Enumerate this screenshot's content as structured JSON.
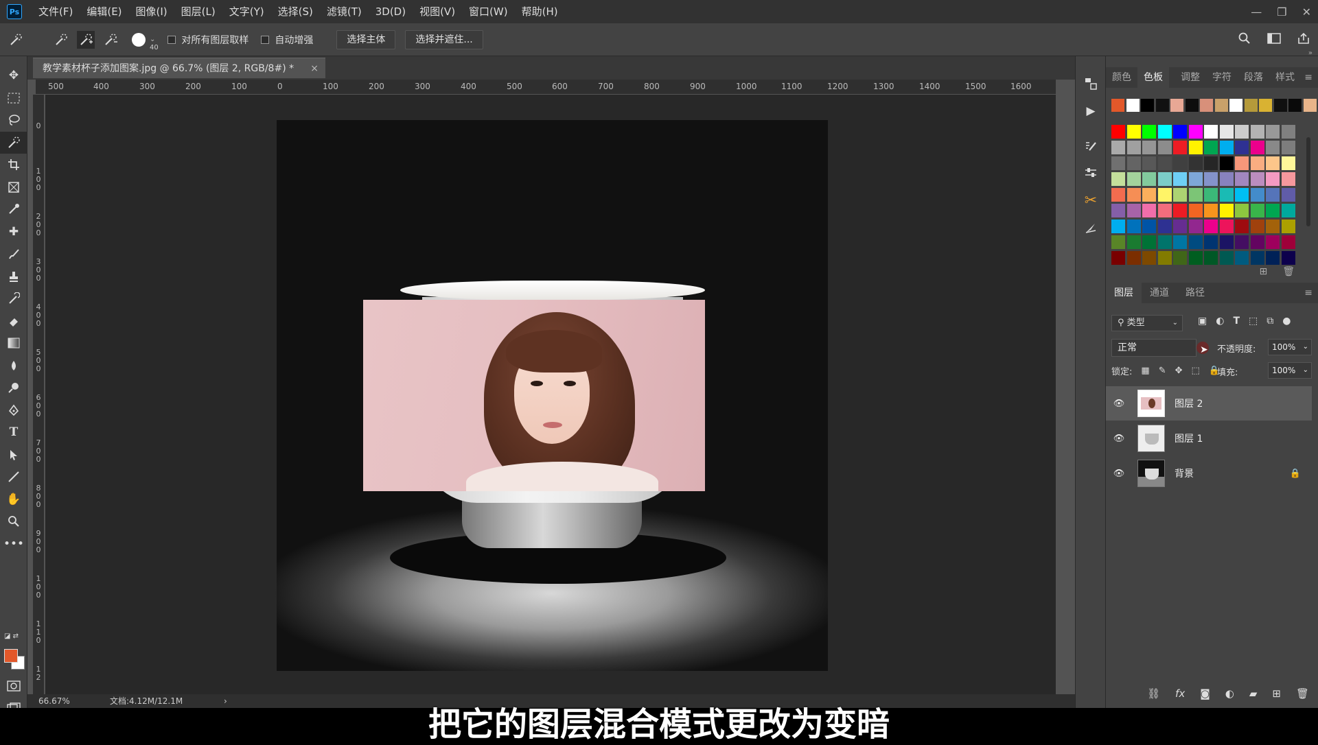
{
  "menubar": {
    "logo": "Ps",
    "items": [
      "文件(F)",
      "编辑(E)",
      "图像(I)",
      "图层(L)",
      "文字(Y)",
      "选择(S)",
      "滤镜(T)",
      "3D(D)",
      "视图(V)",
      "窗口(W)",
      "帮助(H)"
    ]
  },
  "options": {
    "brush_size": "40",
    "sample_all_label": "对所有图层取样",
    "auto_enhance_label": "自动增强",
    "select_subject": "选择主体",
    "select_mask": "选择并遮住..."
  },
  "document": {
    "tab_title": "教学素材杯子添加图案.jpg @ 66.7% (图层 2, RGB/8#) *",
    "close": "×",
    "ruler_top": [
      "500",
      "400",
      "300",
      "200",
      "100",
      "0",
      "100",
      "200",
      "300",
      "400",
      "500",
      "600",
      "700",
      "800",
      "900",
      "1000",
      "1100",
      "1200",
      "1300",
      "1400",
      "1500",
      "1600"
    ],
    "ruler_left": [
      "0",
      "1\n0\n0",
      "2\n0\n0",
      "3\n0\n0",
      "4\n0\n0",
      "5\n0\n0",
      "6\n0\n0",
      "7\n0\n0",
      "8\n0\n0",
      "9\n0\n0",
      "1\n0\n0",
      "1\n1\n0",
      "1\n2"
    ],
    "zoom": "66.67%",
    "doc_size": "文档:4.12M/12.1M",
    "status_arrow": "›"
  },
  "swatches": {
    "tabs": [
      "颜色",
      "色板",
      "调整",
      "字符",
      "段落",
      "样式"
    ],
    "active_tab": "色板",
    "recent": [
      "#e2582a",
      "#ffffff",
      "#000000",
      "#111111",
      "#e8a895",
      "#0d0d0d",
      "#d8907a",
      "#c9a16a",
      "#ffffff",
      "#b59a3a",
      "#d9b232",
      "#101010",
      "#0a0a0a",
      "#e8b48a"
    ],
    "grid": [
      "#ff0000",
      "#ffff00",
      "#00ff00",
      "#00ffff",
      "#0000ff",
      "#ff00ff",
      "#ffffff",
      "#e6e6e6",
      "#cccccc",
      "#b3b3b3",
      "#999999",
      "#808080",
      "#aaaaaa",
      "#a0a0a0",
      "#969696",
      "#8c8c8c",
      "#ed1c24",
      "#fff200",
      "#00a651",
      "#00aeef",
      "#2e3192",
      "#ec008c",
      "#898989",
      "#7d7d7d",
      "#707070",
      "#646464",
      "#585858",
      "#4c4c4c",
      "#404040",
      "#333333",
      "#262626",
      "#000000",
      "#f7977a",
      "#f9ad81",
      "#fdc68a",
      "#fff79a",
      "#c4df9b",
      "#a3d39c",
      "#82ca9d",
      "#7bcdc8",
      "#6ecff6",
      "#7ea7d8",
      "#8493ca",
      "#8882be",
      "#a187be",
      "#bc8dbf",
      "#f49ac2",
      "#f6989d",
      "#f26c4f",
      "#f68e55",
      "#fbaf5c",
      "#fff467",
      "#acd372",
      "#7cc576",
      "#3bb878",
      "#1abbb4",
      "#00bff3",
      "#438ccb",
      "#5574b9",
      "#605ca8",
      "#855fa8",
      "#a763a8",
      "#f06eaa",
      "#f26d7d",
      "#ed1c24",
      "#f26522",
      "#f7941d",
      "#fff200",
      "#8dc63f",
      "#39b54a",
      "#00a651",
      "#00a99d",
      "#00aeef",
      "#0072bc",
      "#0054a6",
      "#2e3192",
      "#662d91",
      "#92278f",
      "#ec008c",
      "#ed145b",
      "#9e0b0f",
      "#a0410d",
      "#a3620a",
      "#aba000",
      "#598527",
      "#1a7b30",
      "#007236",
      "#00746b",
      "#0076a3",
      "#004b80",
      "#003471",
      "#1b1464",
      "#440e62",
      "#630460",
      "#9e005d",
      "#9e0039",
      "#790000",
      "#7b2e00",
      "#7d4900",
      "#827b00",
      "#406618",
      "#005e20",
      "#005826",
      "#005952",
      "#005b7f",
      "#003663",
      "#002157",
      "#0d004c"
    ]
  },
  "layers": {
    "tabs": [
      "图层",
      "通道",
      "路径"
    ],
    "active_tab": "图层",
    "filter_label": "类型",
    "blend_mode": "正常",
    "opacity_label": "不透明度:",
    "opacity_value": "100%",
    "lock_label": "锁定:",
    "fill_label": "填充:",
    "fill_value": "100%",
    "items": [
      {
        "name": "图层 2",
        "selected": true,
        "locked": false
      },
      {
        "name": "图层 1",
        "selected": false,
        "locked": false
      },
      {
        "name": "背景",
        "selected": false,
        "locked": true
      }
    ]
  },
  "subtitle": "把它的图层混合模式更改为变暗"
}
